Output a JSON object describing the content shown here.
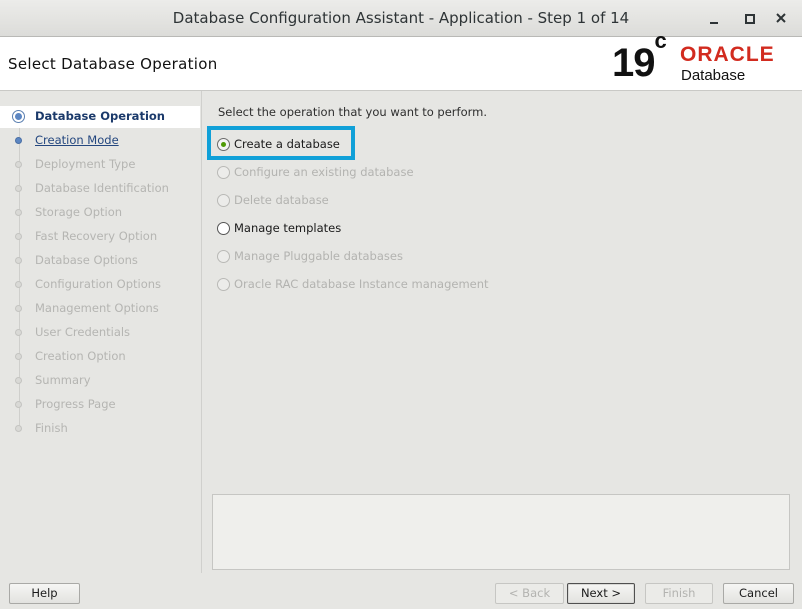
{
  "window": {
    "title": "Database Configuration Assistant - Application - Step 1 of 14",
    "controls": [
      "minimize-icon",
      "maximize-icon",
      "close-icon"
    ]
  },
  "header": {
    "page_title": "Select Database Operation",
    "logo": {
      "version": "19",
      "version_suffix": "c",
      "brand": "ORACLE",
      "product": "Database",
      "brand_color": "#d22b1f"
    }
  },
  "steps": [
    {
      "label": "Database Operation",
      "state": "current"
    },
    {
      "label": "Creation Mode",
      "state": "next"
    },
    {
      "label": "Deployment Type",
      "state": "disabled"
    },
    {
      "label": "Database Identification",
      "state": "disabled"
    },
    {
      "label": "Storage Option",
      "state": "disabled"
    },
    {
      "label": "Fast Recovery Option",
      "state": "disabled"
    },
    {
      "label": "Database Options",
      "state": "disabled"
    },
    {
      "label": "Configuration Options",
      "state": "disabled"
    },
    {
      "label": "Management Options",
      "state": "disabled"
    },
    {
      "label": "User Credentials",
      "state": "disabled"
    },
    {
      "label": "Creation Option",
      "state": "disabled"
    },
    {
      "label": "Summary",
      "state": "disabled"
    },
    {
      "label": "Progress Page",
      "state": "disabled"
    },
    {
      "label": "Finish",
      "state": "disabled"
    }
  ],
  "content": {
    "instruction": "Select the operation that you want to perform.",
    "options": [
      {
        "label": "Create a database",
        "selected": true,
        "enabled": true
      },
      {
        "label": "Configure an existing database",
        "selected": false,
        "enabled": false
      },
      {
        "label": "Delete database",
        "selected": false,
        "enabled": false
      },
      {
        "label": "Manage templates",
        "selected": false,
        "enabled": true
      },
      {
        "label": "Manage Pluggable databases",
        "selected": false,
        "enabled": false
      },
      {
        "label": "Oracle RAC database Instance management",
        "selected": false,
        "enabled": false
      }
    ],
    "highlight_color": "#10a0d8"
  },
  "footer": {
    "help": "Help",
    "back": "< Back",
    "next": "Next >",
    "finish": "Finish",
    "cancel": "Cancel"
  }
}
